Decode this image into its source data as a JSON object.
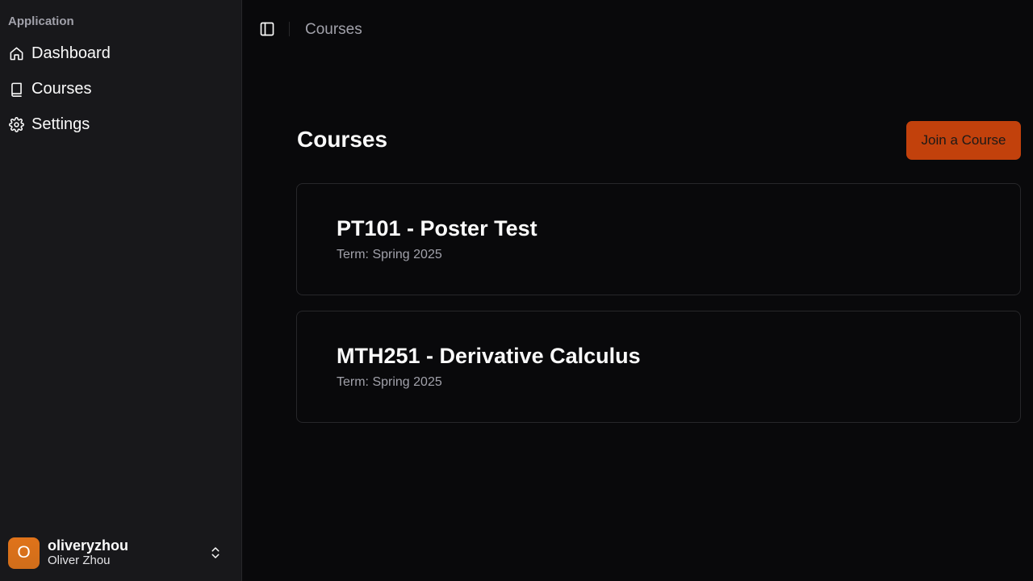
{
  "sidebar": {
    "group_label": "Application",
    "items": [
      {
        "label": "Dashboard",
        "icon": "home-icon"
      },
      {
        "label": "Courses",
        "icon": "book-icon"
      },
      {
        "label": "Settings",
        "icon": "gear-icon"
      }
    ],
    "user": {
      "initial": "O",
      "handle": "oliveryzhou",
      "name": "Oliver Zhou",
      "avatar_color": "#d97706"
    }
  },
  "header": {
    "breadcrumb": "Courses"
  },
  "main": {
    "title": "Courses",
    "join_button": "Join a Course",
    "accent_color": "#c2410c",
    "courses": [
      {
        "title": "PT101 - Poster Test",
        "term": "Term: Spring 2025"
      },
      {
        "title": "MTH251 - Derivative Calculus",
        "term": "Term: Spring 2025"
      }
    ]
  }
}
